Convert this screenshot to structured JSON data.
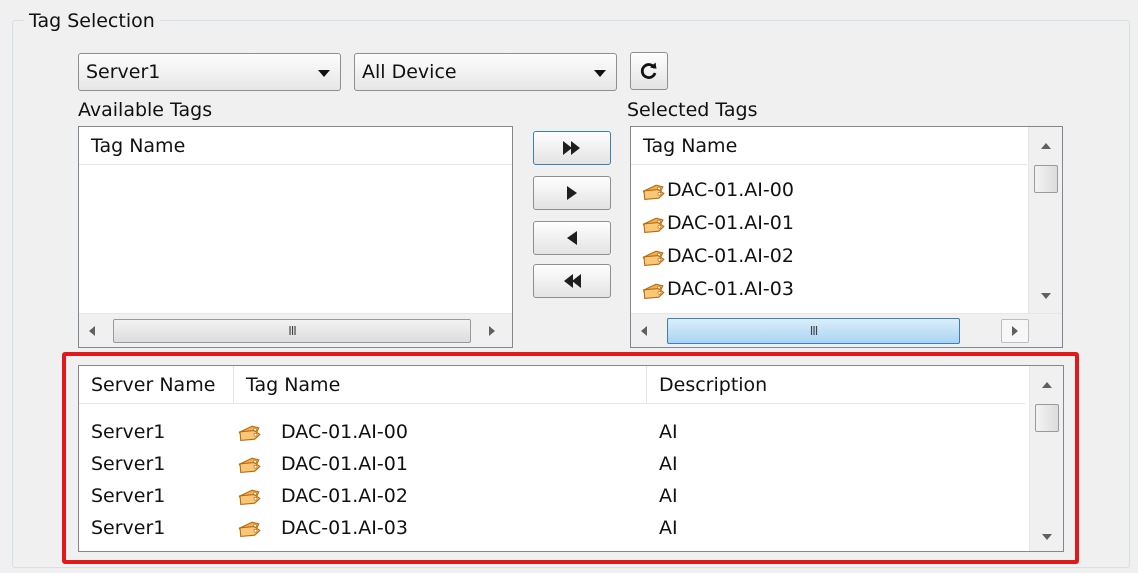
{
  "group_title": "Tag Selection",
  "server_combo": {
    "value": "Server1"
  },
  "device_combo": {
    "value": "All Device"
  },
  "refresh_label": "C",
  "available": {
    "label": "Available Tags",
    "column": "Tag Name",
    "hscroll_grip": "III"
  },
  "selected": {
    "label": "Selected Tags",
    "column": "Tag Name",
    "items": [
      "DAC-01.AI-00",
      "DAC-01.AI-01",
      "DAC-01.AI-02",
      "DAC-01.AI-03"
    ],
    "hscroll_grip": "III"
  },
  "transfer_buttons": [
    "add-all",
    "add-selected",
    "remove-selected",
    "remove-all"
  ],
  "detail_table": {
    "columns": [
      "Server Name",
      "Tag Name",
      "Description"
    ],
    "rows": [
      {
        "server": "Server1",
        "tag": "DAC-01.AI-00",
        "description": "AI"
      },
      {
        "server": "Server1",
        "tag": "DAC-01.AI-01",
        "description": "AI"
      },
      {
        "server": "Server1",
        "tag": "DAC-01.AI-02",
        "description": "AI"
      },
      {
        "server": "Server1",
        "tag": "DAC-01.AI-03",
        "description": "AI"
      }
    ]
  },
  "colors": {
    "highlight": "#e01a1a",
    "active_thumb": "#a9d4f2",
    "tag_icon": "#e8a23a"
  },
  "icons": [
    "refresh-icon",
    "tag-icon",
    "double-right-arrow-icon",
    "right-arrow-icon",
    "left-arrow-icon",
    "double-left-arrow-icon"
  ]
}
